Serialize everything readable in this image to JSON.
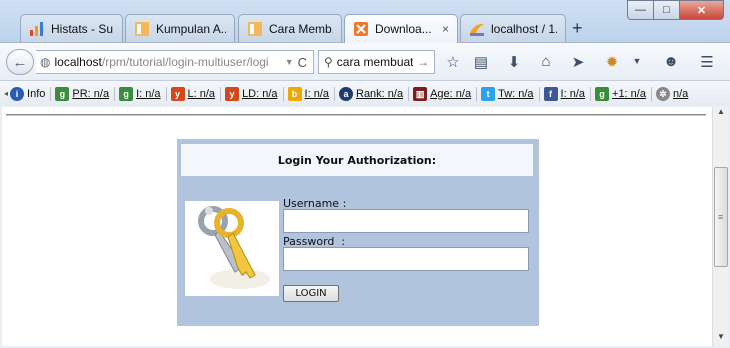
{
  "window": {
    "controls": {
      "minimize": "—",
      "maximize": "□",
      "close": "✕"
    }
  },
  "tabs": [
    {
      "label": "Histats - Su...",
      "icon": "histats-bar-chart-icon",
      "active": false
    },
    {
      "label": "Kumpulan A...",
      "icon": "blogger-page-icon",
      "active": false
    },
    {
      "label": "Cara Memb...",
      "icon": "blogger-page-icon",
      "active": false
    },
    {
      "label": "Downloa...",
      "icon": "xampp-icon",
      "active": true
    },
    {
      "label": "localhost / 1...",
      "icon": "phpmyadmin-icon",
      "active": false
    }
  ],
  "tab_close": "×",
  "new_tab": "+",
  "navbar": {
    "back": "←",
    "url_host": "localhost",
    "url_path": "/rpm/tutorial/login-multiuser/logi",
    "url_dropdown": "▼",
    "reload": "C",
    "search_value": "cara membuat",
    "search_go": "→"
  },
  "seo_bar": [
    {
      "text": "Info",
      "icon": "info-icon",
      "color": "#2a5db0"
    },
    {
      "text": "PR: n/a",
      "icon": "google-icon",
      "color": "#3a8d3a"
    },
    {
      "text": "I: n/a",
      "icon": "google-icon",
      "color": "#3a8d3a"
    },
    {
      "text": "L: n/a",
      "icon": "yahoo-icon",
      "color": "#d4481a"
    },
    {
      "text": "LD: n/a",
      "icon": "yahoo-icon",
      "color": "#d4481a"
    },
    {
      "text": "I: n/a",
      "icon": "bing-icon",
      "color": "#f0a800"
    },
    {
      "text": "Rank: n/a",
      "icon": "alexa-icon",
      "color": "#1d3c6e"
    },
    {
      "text": "Age: n/a",
      "icon": "archive-icon",
      "color": "#7a1f1f"
    },
    {
      "text": "Tw: n/a",
      "icon": "twitter-icon",
      "color": "#2aa3ef"
    },
    {
      "text": "I: n/a",
      "icon": "facebook-icon",
      "color": "#3b5998"
    },
    {
      "text": "+1: n/a",
      "icon": "google-icon",
      "color": "#3a8d3a"
    },
    {
      "text": "n/a",
      "icon": "gear-icon",
      "color": "#888888"
    }
  ],
  "login": {
    "title": "Login Your Authorization:",
    "username_label": "Username :",
    "password_label": "Password  :",
    "username_value": "",
    "password_value": "",
    "submit_label": "LOGIN",
    "image_icon": "keys-icon"
  }
}
